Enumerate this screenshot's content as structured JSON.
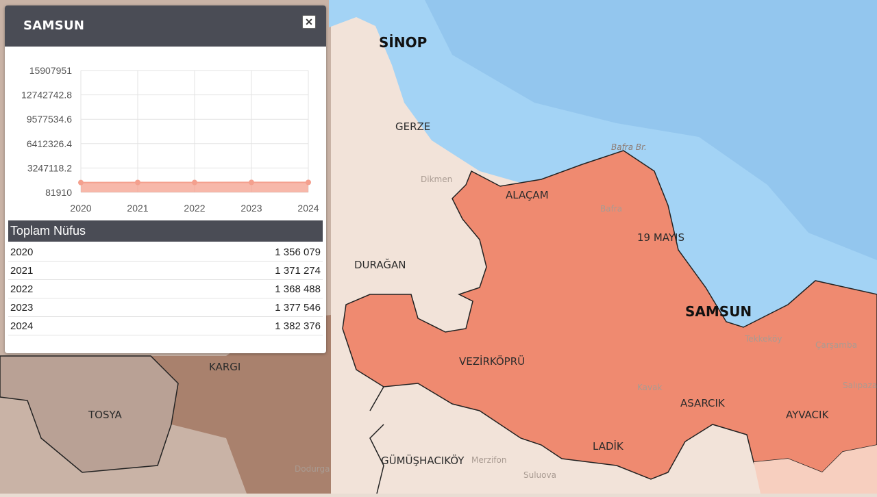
{
  "popup": {
    "title": "SAMSUN",
    "close_icon": "close-icon",
    "table_title": "Toplam Nüfus",
    "rows": [
      {
        "year": "2020",
        "value": "1 356 079"
      },
      {
        "year": "2021",
        "value": "1 371 274"
      },
      {
        "year": "2022",
        "value": "1 368 488"
      },
      {
        "year": "2023",
        "value": "1 377 546"
      },
      {
        "year": "2024",
        "value": "1 382 376"
      }
    ]
  },
  "chart_data": {
    "type": "area",
    "x": [
      2020,
      2021,
      2022,
      2023,
      2024
    ],
    "values": [
      1356079,
      1371274,
      1368488,
      1377546,
      1382376
    ],
    "ylim": [
      81910,
      15907951
    ],
    "yticks": [
      "15907951",
      "12742742.8",
      "9577534.6",
      "6412326.4",
      "3247118.2",
      "81910"
    ],
    "xticks": [
      "2020",
      "2021",
      "2022",
      "2023",
      "2024"
    ],
    "grid": true,
    "color": "#f4a08e"
  },
  "map": {
    "labels": {
      "sinop": "SİNOP",
      "gerze": "GERZE",
      "alacam": "ALAÇAM",
      "bafra": "Bafra",
      "bafra_br": "Bafra Br.",
      "ondokuz_mayis": "19 MAYIS",
      "duragan": "DURAĞAN",
      "samsun": "SAMSUN",
      "tekkekoy": "Tekkeköy",
      "carsamba": "Çarşamba",
      "vezirkopru": "VEZİRKÖPRÜ",
      "kavak": "Kavak",
      "asarcik": "ASARCIK",
      "ayvacik": "AYVACIK",
      "ladik": "LADİK",
      "kargi": "KARGI",
      "tosya": "TOSYA",
      "gumushacikoy": "GÜMÜŞHACIKÖY",
      "merzifon": "Merzifon",
      "suluova": "Suluova",
      "dodurga": "Dodurga",
      "dikmen": "Dikmen",
      "salipazari": "Salıpaza"
    },
    "colors": {
      "sea": "#a3d3f5",
      "sea_deep": "#93c6ee",
      "samsun_region": "#ef8a70",
      "land": "#f3e0d5",
      "west_land": "#a88a7a"
    }
  }
}
